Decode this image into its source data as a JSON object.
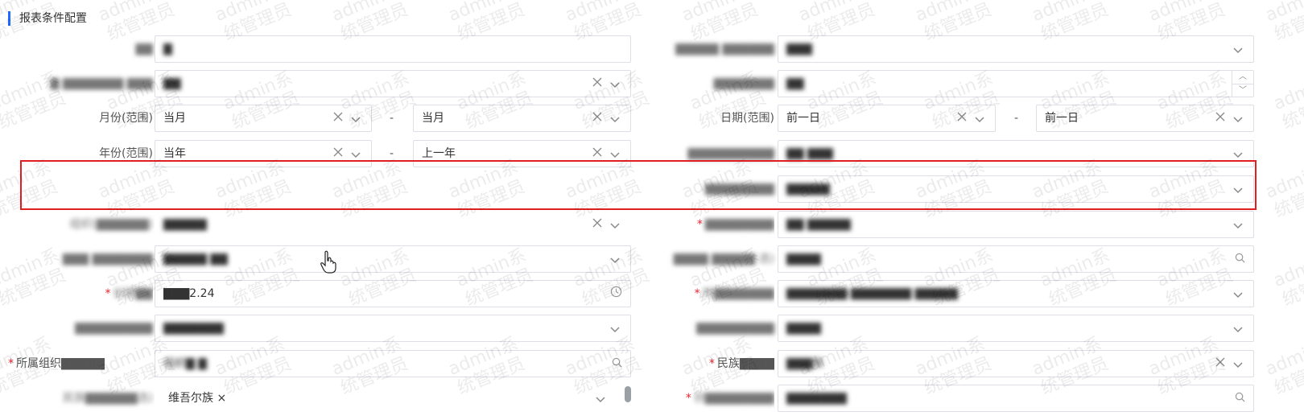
{
  "section_title": "报表条件配置",
  "watermark": {
    "line1": "admin系",
    "line2": "统管理员"
  },
  "fields": {
    "r1_left": {
      "label": "▇▇",
      "value": "▇"
    },
    "r1_right": {
      "label": "▇▇▇▇▇ ▇▇▇▇▇▇",
      "value": "▇▇▇"
    },
    "r2_left": {
      "label": "▇ ▇▇▇▇▇▇▇ ▇▇▇",
      "value": "▇▇"
    },
    "r2_right": {
      "label": "▇▇▇▇▇▇▇",
      "value": "▇▇"
    },
    "r3_left": {
      "label": "月份(范围)",
      "value_from": "当月",
      "value_to": "当月",
      "separator": "-"
    },
    "r3_right": {
      "label": "日期(范围)",
      "value_from": "前一日",
      "value_to": "前一日",
      "separator": "-"
    },
    "r4_left": {
      "label": "年份(范围)",
      "value_from": "当年",
      "value_to": "上一年",
      "separator": "-"
    },
    "r4_right": {
      "label": "▇▇▇▇▇▇▇▇▇▇",
      "value": "▇▇ ▇▇▇"
    },
    "r5_right": {
      "label": "▇▇▇▇▇▇▇▇",
      "value": "▇▇▇▇▇"
    },
    "r6_left": {
      "label": "组织(▇▇▇▇▇▇)",
      "value": "▇▇▇▇▇"
    },
    "r6_right": {
      "label": "▇▇▇▇▇▇▇▇",
      "value": "▇▇ ▇▇▇▇▇"
    },
    "r7_left": {
      "label": "▇▇▇ ▇▇▇▇▇▇▇",
      "value": "▇▇▇▇▇ ▇▇"
    },
    "r7_right": {
      "label": "▇▇▇▇ ▇▇▇▇▇ 选)",
      "value": "▇▇▇▇"
    },
    "r8_left": {
      "label": "创建▇▇",
      "value": "▇▇▇2.24"
    },
    "r8_right": {
      "label": "所▇▇▇▇▇▇▇",
      "value": "▇▇▇▇▇▇▇ ▇▇▇▇▇▇▇ ▇▇▇▇▇"
    },
    "r9_left": {
      "label": "▇▇▇▇▇▇▇▇▇",
      "value": "▇▇▇▇▇▇▇"
    },
    "r9_right": {
      "label": "▇▇▇▇▇▇▇▇▇",
      "value": "▇▇▇▇"
    },
    "r10_left": {
      "label": "所属组织▇▇▇▇▇",
      "value": "组织▇ ▇"
    },
    "r10_right": {
      "label": "民族▇▇▇▇",
      "value": "▇▇▇族"
    },
    "r11_left": {
      "label": "民族▇▇▇▇▇▇选)",
      "tag": "维吾尔族"
    },
    "r11_right": {
      "label": "创▇▇▇▇▇▇▇▇",
      "value": "▇▇▇▇▇▇▇"
    }
  }
}
